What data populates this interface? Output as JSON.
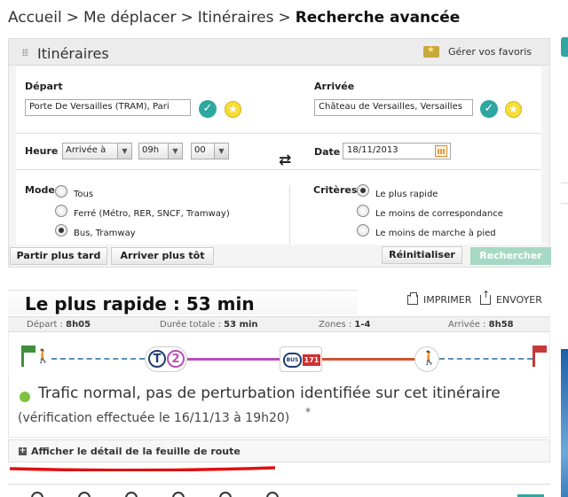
{
  "breadcrumb": {
    "items": [
      "Accueil",
      "Me déplacer",
      "Itinéraires"
    ],
    "separator": ">",
    "current": "Recherche avancée"
  },
  "panel": {
    "title": "Itinéraires",
    "favorites_label": "Gérer vos favoris",
    "depart_label": "Départ",
    "depart_value": "Porte De Versailles (TRAM), Pari",
    "arrivee_label": "Arrivée",
    "arrivee_value": "Château de Versailles, Versailles",
    "heure_label": "Heure",
    "heure_mode": "Arrivée à",
    "heure_hours": "09h",
    "heure_minutes": "00",
    "date_label": "Date",
    "date_value": "18/11/2013",
    "mode_label": "Mode",
    "mode_options": [
      {
        "label": "Tous",
        "selected": false
      },
      {
        "label": "Ferré (Métro, RER, SNCF, Tramway)",
        "selected": false
      },
      {
        "label": "Bus, Tramway",
        "selected": true
      }
    ],
    "criteres_label": "Critères",
    "criteres_options": [
      {
        "label": "Le plus rapide",
        "selected": true
      },
      {
        "label": "Le moins de correspondance",
        "selected": false
      },
      {
        "label": "Le moins de marche à pied",
        "selected": false
      }
    ],
    "buttons": {
      "later": "Partir plus tard",
      "earlier": "Arriver plus tôt",
      "reset": "Réinitialiser",
      "search": "Rechercher"
    }
  },
  "result": {
    "title": "Le plus rapide : 53 min",
    "print": "IMPRIMER",
    "send": "ENVOYER",
    "depart_label": "Départ :",
    "depart_time": "8h05",
    "duration_label": "Durée totale :",
    "duration": "53 min",
    "zones_label": "Zones :",
    "zones": "1-4",
    "arrival_label": "Arrivée :",
    "arrival_time": "8h58",
    "line_tram": "T",
    "line_tram_num": "2",
    "line_bus": "BUS",
    "line_bus_num": "171",
    "trafic": "Trafic normal, pas de perturbation identifiée sur cet itinéraire",
    "verification": "(vérification effectuée le 16/11/13 à 19h20)",
    "asterisk": "*",
    "detail_label": "Afficher le détail de la feuille de route"
  },
  "colors": {
    "accent_teal": "#2da7a0",
    "tram_purple": "#b74fb4",
    "bus_red": "#d0532f",
    "walk_blue": "#5a8fb4",
    "status_green": "#7fc241",
    "annotation_red": "#e01010"
  },
  "icons": {
    "favorites": "folder-star-icon",
    "confirm": "check-icon",
    "favorite": "star-icon",
    "swap": "swap-arrows-icon",
    "calendar": "calendar-icon",
    "print": "printer-icon",
    "send": "share-icon",
    "walk": "walking-person-icon",
    "start": "green-flag-icon",
    "end": "red-flag-icon",
    "expand": "plus-icon"
  }
}
